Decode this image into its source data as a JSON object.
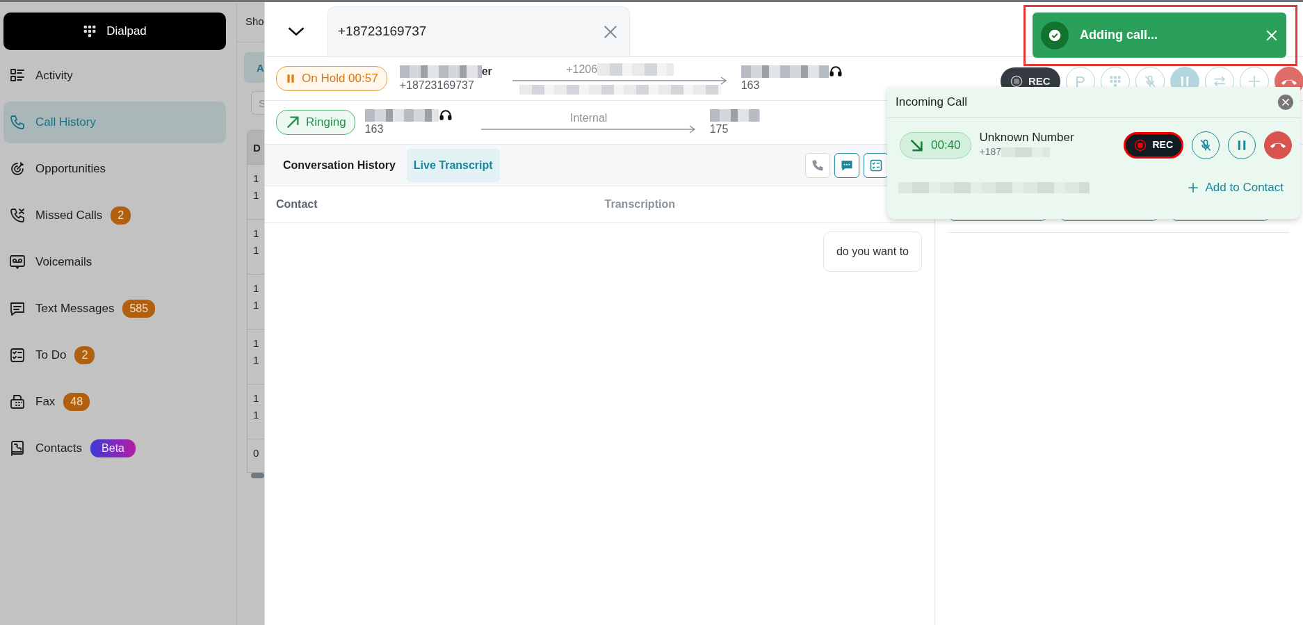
{
  "sidebar": {
    "dialpad_button": "Dialpad",
    "items": [
      {
        "label": "Activity",
        "selected": false
      },
      {
        "label": "Call History",
        "selected": true
      },
      {
        "label": "Opportunities",
        "selected": false
      },
      {
        "label": "Missed Calls",
        "selected": false,
        "badge": {
          "text": "2",
          "kind": "count"
        }
      },
      {
        "label": "Voicemails",
        "selected": false
      },
      {
        "label": "Text Messages",
        "selected": false,
        "badge": {
          "text": "585",
          "kind": "count"
        }
      },
      {
        "label": "To Do",
        "selected": false,
        "badge": {
          "text": "2",
          "kind": "count"
        }
      },
      {
        "label": "Fax",
        "selected": false,
        "badge": {
          "text": "48",
          "kind": "count"
        }
      },
      {
        "label": "Contacts",
        "selected": false,
        "badge": {
          "text": "Beta",
          "kind": "beta"
        }
      }
    ]
  },
  "background_page": {
    "header": "Sho",
    "tab": "A",
    "search_placeholder": "S",
    "table": {
      "column_1": "D",
      "rows": [
        [
          "1",
          "1"
        ],
        [
          "1",
          "1"
        ],
        [
          "1",
          "1"
        ],
        [
          "1",
          "1"
        ],
        [
          "1",
          "1"
        ],
        [
          "0"
        ]
      ]
    }
  },
  "call_panel": {
    "tab": {
      "number": "+18723169737"
    },
    "calls": [
      {
        "kind": "hold",
        "status": "On Hold 00:57",
        "from_suffix": "er",
        "from_number": "+18723169737",
        "via": "+1206",
        "to_number": "163"
      },
      {
        "kind": "ringing",
        "status": "Ringing",
        "from_number": "163",
        "via": "Internal",
        "to_number": "175"
      }
    ],
    "controls": [
      {
        "kind": "rec",
        "label": "REC"
      },
      {
        "kind": "park",
        "label": "P"
      },
      {
        "kind": "keypad"
      },
      {
        "kind": "mute"
      },
      {
        "kind": "hold",
        "active": true
      },
      {
        "kind": "transfer"
      },
      {
        "kind": "add"
      },
      {
        "kind": "hangup"
      }
    ],
    "tabs": [
      {
        "label": "Conversation History",
        "selected": false
      },
      {
        "label": "Live Transcript",
        "selected": true
      }
    ],
    "transcript": {
      "columns": [
        "Contact",
        "Transcription"
      ],
      "messages": [
        "do you want to"
      ]
    }
  },
  "incoming_call": {
    "title": "Incoming Call",
    "duration": "00:40",
    "caller": "Unknown Number",
    "number": "+187",
    "controls": [
      {
        "kind": "rec",
        "label": "REC"
      },
      {
        "kind": "mute"
      },
      {
        "kind": "hold"
      },
      {
        "kind": "hangup"
      }
    ],
    "add_contact": "Add to Contact"
  },
  "toast": {
    "message": "Adding call..."
  }
}
